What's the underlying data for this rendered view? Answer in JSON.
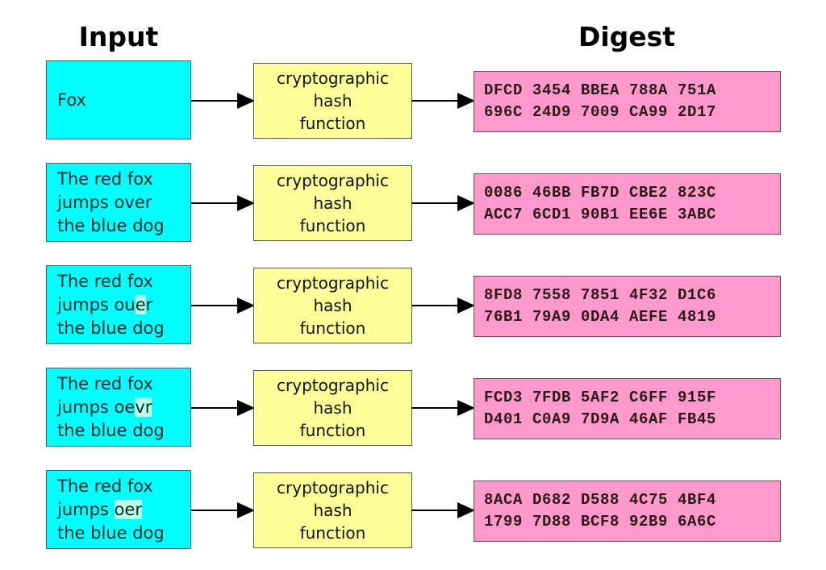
{
  "headers": {
    "input": "Input",
    "digest": "Digest"
  },
  "colors": {
    "input_fill": "#00ffff",
    "hash_fill": "#ffff99",
    "digest_fill": "#ff99cc",
    "highlight": "#b8ffe8"
  },
  "rows": [
    {
      "input_lines": [
        {
          "before": "Fox",
          "hl": "",
          "after": ""
        }
      ],
      "hash_label": "cryptographic\nhash\nfunction",
      "digest": [
        "DFCD 3454 BBEA 788A 751A",
        "696C 24D9 7009 CA99 2D17"
      ]
    },
    {
      "input_lines": [
        {
          "before": "The red fox",
          "hl": "",
          "after": ""
        },
        {
          "before": "jumps over",
          "hl": "",
          "after": ""
        },
        {
          "before": "the blue dog",
          "hl": "",
          "after": ""
        }
      ],
      "hash_label": "cryptographic\nhash\nfunction",
      "digest": [
        "0086 46BB FB7D CBE2 823C",
        "ACC7 6CD1 90B1 EE6E 3ABC"
      ]
    },
    {
      "input_lines": [
        {
          "before": "The red fox",
          "hl": "",
          "after": ""
        },
        {
          "before": "jumps ou",
          "hl": "e",
          "after": "r"
        },
        {
          "before": "the blue dog",
          "hl": "",
          "after": ""
        }
      ],
      "hash_label": "cryptographic\nhash\nfunction",
      "digest": [
        "8FD8 7558 7851 4F32 D1C6",
        "76B1 79A9 0DA4 AEFE 4819"
      ]
    },
    {
      "input_lines": [
        {
          "before": "The red fox",
          "hl": "",
          "after": ""
        },
        {
          "before": "jumps oe",
          "hl": "vr",
          "after": ""
        },
        {
          "before": "the blue dog",
          "hl": "",
          "after": ""
        }
      ],
      "hash_label": "cryptographic\nhash\nfunction",
      "digest": [
        "FCD3 7FDB 5AF2 C6FF 915F",
        "D401 C0A9 7D9A 46AF FB45"
      ]
    },
    {
      "input_lines": [
        {
          "before": "The red fox",
          "hl": "",
          "after": ""
        },
        {
          "before": "jumps ",
          "hl": "oer",
          "after": ""
        },
        {
          "before": "the blue dog",
          "hl": "",
          "after": ""
        }
      ],
      "hash_label": "cryptographic\nhash\nfunction",
      "digest": [
        "8ACA D682 D588 4C75 4BF4",
        "1799 7D88 BCF8 92B9 6A6C"
      ]
    }
  ]
}
